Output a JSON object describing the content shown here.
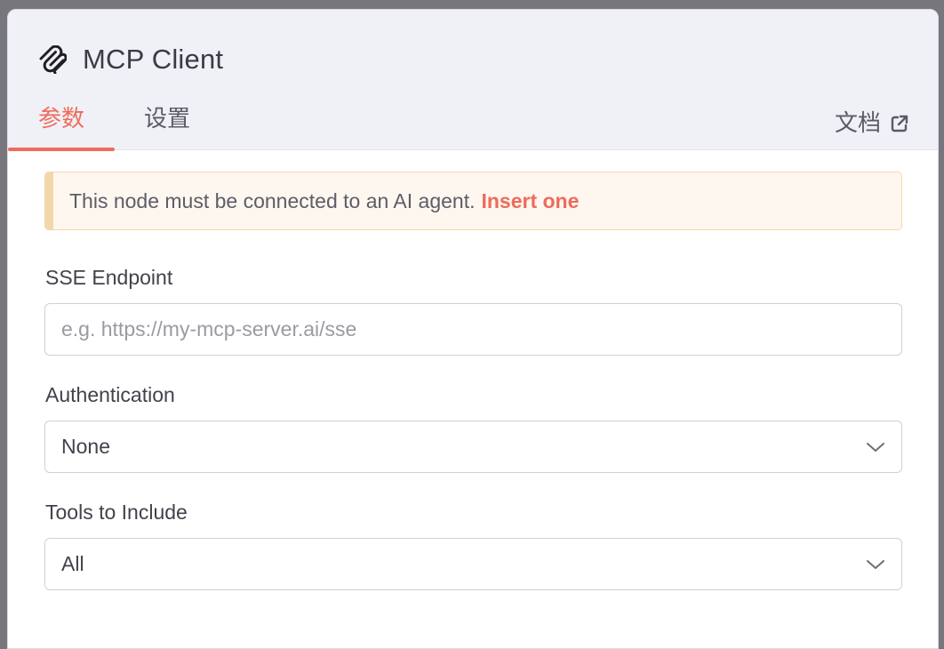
{
  "header": {
    "title": "MCP Client",
    "icon": "mcp-logo-icon"
  },
  "tabs": [
    {
      "label": "参数",
      "active": true
    },
    {
      "label": "设置",
      "active": false
    }
  ],
  "docs": {
    "label": "文档",
    "icon": "external-link-icon"
  },
  "notice": {
    "text": "This node must be connected to an AI agent.",
    "link": "Insert one"
  },
  "fields": {
    "sse_endpoint": {
      "label": "SSE Endpoint",
      "value": "",
      "placeholder": "e.g. https://my-mcp-server.ai/sse"
    },
    "authentication": {
      "label": "Authentication",
      "value": "None"
    },
    "tools": {
      "label": "Tools to Include",
      "value": "All"
    }
  },
  "colors": {
    "accent": "#ef6b5a",
    "notice_bg": "#fdf7ef",
    "notice_border": "#f3d7ac",
    "header_bg": "#f0f1f7"
  }
}
